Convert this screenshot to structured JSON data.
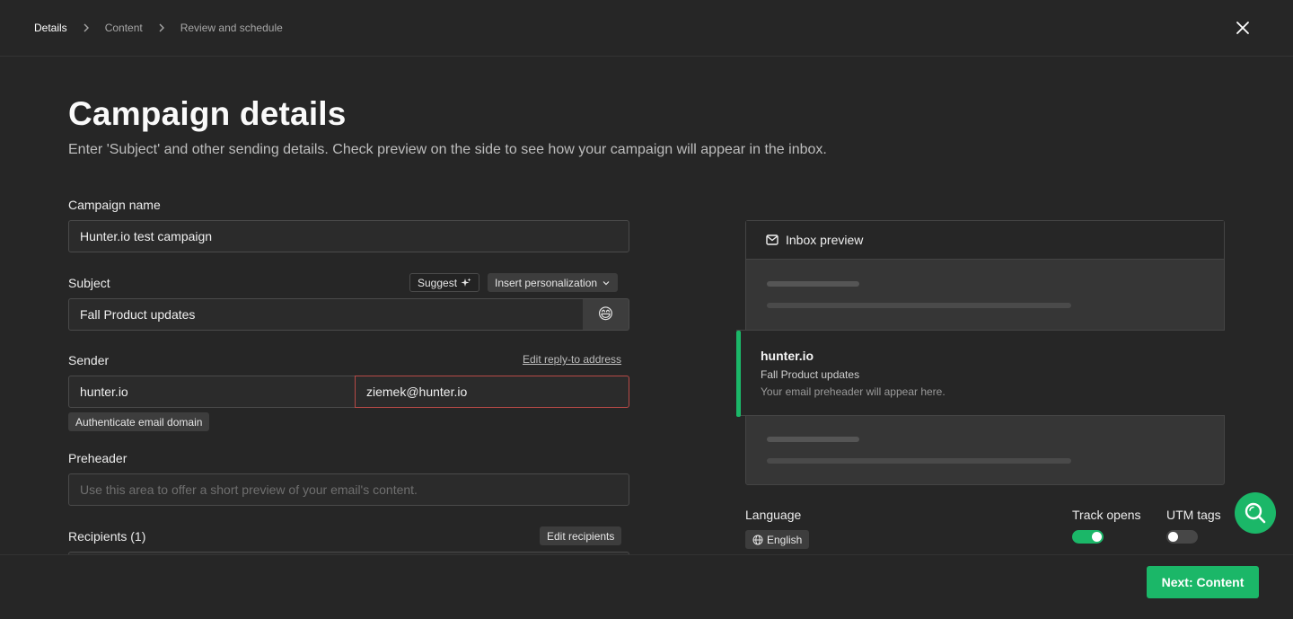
{
  "breadcrumb": {
    "items": [
      "Details",
      "Content",
      "Review and schedule"
    ],
    "active_index": 0
  },
  "page": {
    "title": "Campaign details",
    "subtitle": "Enter 'Subject' and other sending details. Check preview on the side to see how your campaign will appear in the inbox."
  },
  "form": {
    "campaign_name": {
      "label": "Campaign name",
      "value": "Hunter.io test campaign"
    },
    "subject": {
      "label": "Subject",
      "value": "Fall Product updates",
      "suggest_label": "Suggest",
      "personalization_label": "Insert personalization",
      "emoji": "😄"
    },
    "sender": {
      "label": "Sender",
      "edit_reply_to": "Edit reply-to address",
      "name_value": "hunter.io",
      "email_value": "ziemek@hunter.io",
      "authenticate_label": "Authenticate email domain"
    },
    "preheader": {
      "label": "Preheader",
      "placeholder": "Use this area to offer a short preview of your email's content."
    },
    "recipients": {
      "label": "Recipients (1)",
      "edit_label": "Edit recipients"
    }
  },
  "inbox_preview": {
    "title": "Inbox preview",
    "sender": "hunter.io",
    "subject": "Fall Product updates",
    "preheader": "Your email preheader will appear here."
  },
  "settings": {
    "language_label": "Language",
    "language_value": "English",
    "track_opens_label": "Track opens",
    "track_opens_on": true,
    "utm_tags_label": "UTM tags",
    "utm_tags_on": false
  },
  "footer": {
    "next_label": "Next: Content"
  },
  "colors": {
    "accent": "#1bb768",
    "error_border": "#b74a47",
    "background": "#262626"
  }
}
